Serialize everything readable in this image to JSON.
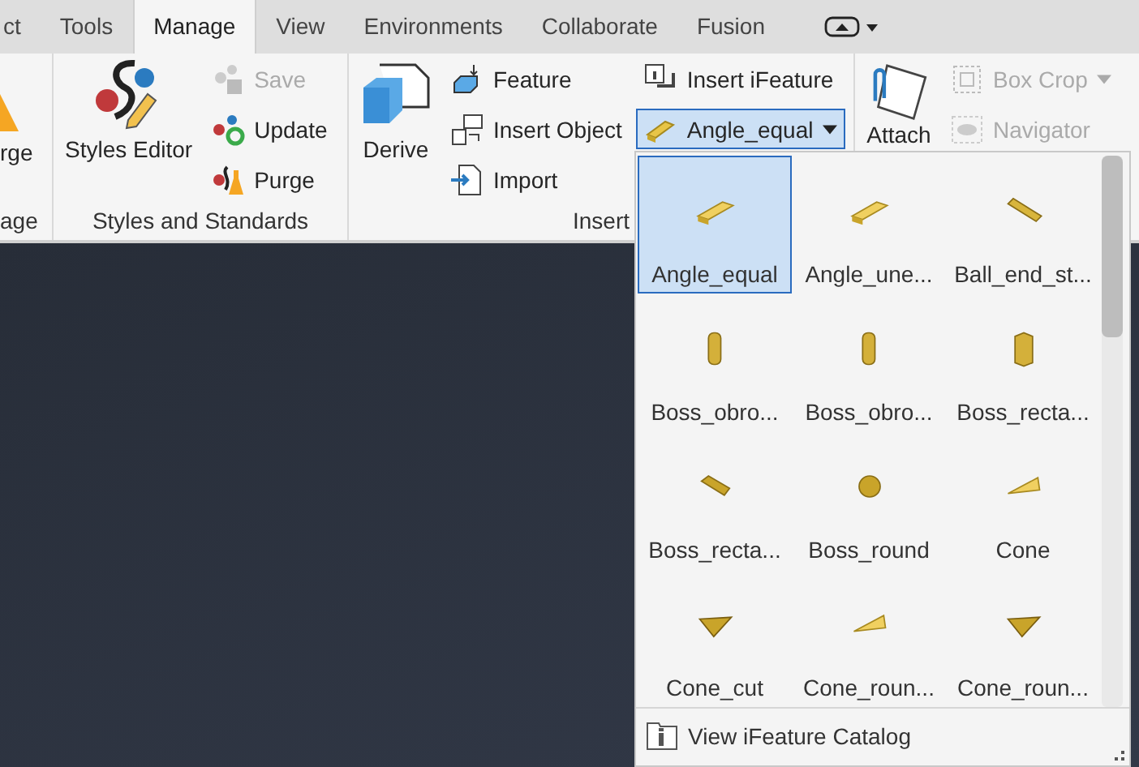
{
  "tabs": [
    {
      "label": "ct",
      "selected": false
    },
    {
      "label": "Tools",
      "selected": false
    },
    {
      "label": "Manage",
      "selected": true
    },
    {
      "label": "View",
      "selected": false
    },
    {
      "label": "Environments",
      "selected": false
    },
    {
      "label": "Collaborate",
      "selected": false
    },
    {
      "label": "Fusion",
      "selected": false
    }
  ],
  "panels": [
    {
      "label": "age",
      "buttons": [
        {
          "kind": "large",
          "label": "rge",
          "disabled": false
        }
      ]
    },
    {
      "label": "Styles and Standards",
      "buttons": [
        {
          "kind": "large",
          "label": "Styles Editor",
          "disabled": false
        },
        {
          "kind": "small",
          "label": "Save",
          "disabled": true
        },
        {
          "kind": "small",
          "label": "Update",
          "disabled": false
        },
        {
          "kind": "small",
          "label": "Purge",
          "disabled": false
        }
      ]
    },
    {
      "label": "Insert",
      "buttons": [
        {
          "kind": "large",
          "label": "Derive",
          "disabled": false
        },
        {
          "kind": "small",
          "label": "Feature",
          "disabled": false
        },
        {
          "kind": "small",
          "label": "Insert Object",
          "disabled": false
        },
        {
          "kind": "small",
          "label": "Import",
          "disabled": false
        },
        {
          "kind": "small",
          "label": "Insert iFeature",
          "disabled": false
        },
        {
          "kind": "split",
          "label": "Angle_equal",
          "disabled": false,
          "open": true
        }
      ]
    },
    {
      "buttons": [
        {
          "kind": "large",
          "label": "Attach",
          "disabled": false
        },
        {
          "kind": "menu",
          "label": "Box Crop",
          "disabled": true
        },
        {
          "kind": "small",
          "label": "Navigator",
          "disabled": true
        }
      ]
    }
  ],
  "gallery": {
    "items": [
      {
        "label": "Angle_equal",
        "selected": true
      },
      {
        "label": "Angle_une...",
        "selected": false
      },
      {
        "label": "Ball_end_st...",
        "selected": false
      },
      {
        "label": "Boss_obro...",
        "selected": false
      },
      {
        "label": "Boss_obro...",
        "selected": false
      },
      {
        "label": "Boss_recta...",
        "selected": false
      },
      {
        "label": "Boss_recta...",
        "selected": false
      },
      {
        "label": "Boss_round",
        "selected": false
      },
      {
        "label": "Cone",
        "selected": false
      },
      {
        "label": "Cone_cut",
        "selected": false
      },
      {
        "label": "Cone_roun...",
        "selected": false
      },
      {
        "label": "Cone_roun...",
        "selected": false
      }
    ],
    "footer": "View iFeature Catalog"
  }
}
